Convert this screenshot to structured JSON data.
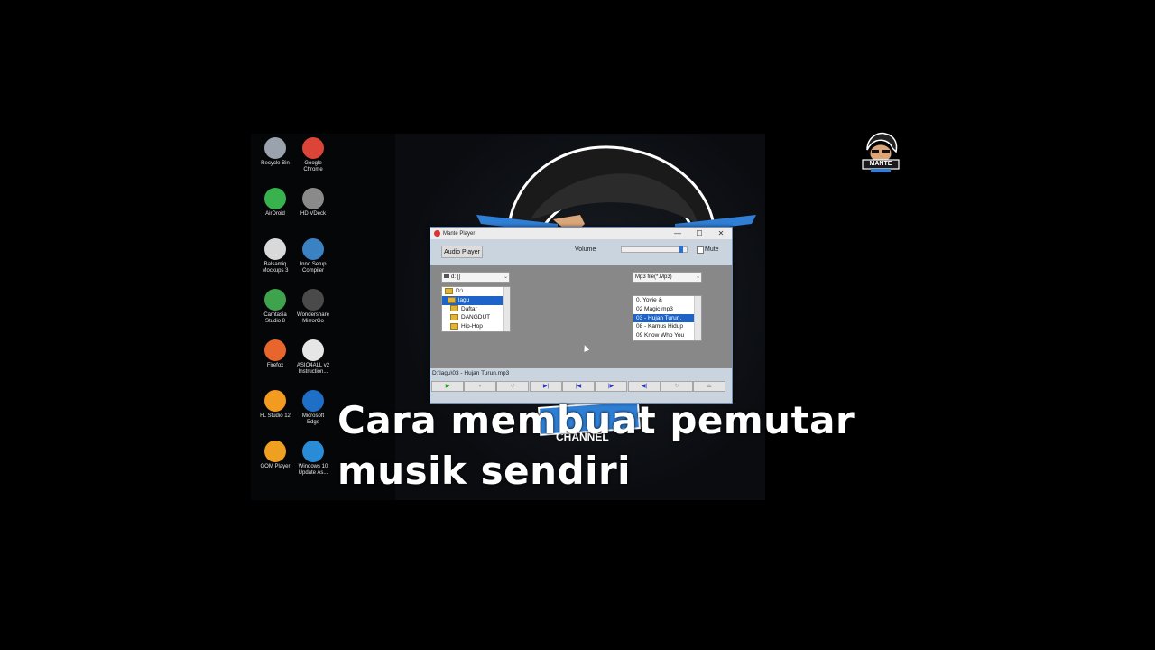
{
  "desktop": {
    "icons": [
      {
        "label": "Recycle Bin",
        "icon": "recycle-bin-icon",
        "color": "#9aa3ad"
      },
      {
        "label": "Google\nChrome",
        "icon": "chrome-icon",
        "color": "#db4437"
      },
      {
        "label": "AirDroid",
        "icon": "airdroid-icon",
        "color": "#37b24d"
      },
      {
        "label": "HD VDeck",
        "icon": "hd-vdeck-icon",
        "color": "#8a8a8a"
      },
      {
        "label": "Balsamiq\nMockups 3",
        "icon": "balsamiq-icon",
        "color": "#d9d9d9"
      },
      {
        "label": "Inno Setup\nCompiler",
        "icon": "inno-setup-icon",
        "color": "#3b82c4"
      },
      {
        "label": "Camtasia\nStudio 8",
        "icon": "camtasia-icon",
        "color": "#3fa34d"
      },
      {
        "label": "Wondershare\nMirrorGo",
        "icon": "mirrorgo-icon",
        "color": "#4a4a4a"
      },
      {
        "label": "Firefox",
        "icon": "firefox-icon",
        "color": "#e8652b"
      },
      {
        "label": "ASIO4ALL v2\nInstruction...",
        "icon": "pdf-icon",
        "color": "#e6e6e6"
      },
      {
        "label": "FL Studio 12",
        "icon": "fl-studio-icon",
        "color": "#f29b1f"
      },
      {
        "label": "Microsoft\nEdge",
        "icon": "edge-icon",
        "color": "#1e6fc8"
      },
      {
        "label": "GOM Player",
        "icon": "gom-player-icon",
        "color": "#f0a020"
      },
      {
        "label": "Windows 10\nUpdate As...",
        "icon": "windows-icon",
        "color": "#2a8bd6"
      }
    ]
  },
  "window": {
    "title": "Mante Player",
    "controls": {
      "minimize": "—",
      "maximize": "☐",
      "close": "✕"
    },
    "toolbar": {
      "audio_player_label": "Audio Player",
      "volume_label": "Volume",
      "volume_level": 0.94,
      "mute_label": "Mute"
    },
    "drive_combo": "d: []",
    "filter_combo": "Mp3 file(*.Mp3)",
    "folders": [
      {
        "name": "D:\\",
        "selected": false,
        "indent": 0
      },
      {
        "name": "lagu",
        "selected": true,
        "indent": 1
      },
      {
        "name": "Daftar",
        "selected": false,
        "indent": 2
      },
      {
        "name": "DANGDUT",
        "selected": false,
        "indent": 2
      },
      {
        "name": "Hip-Hop",
        "selected": false,
        "indent": 2
      }
    ],
    "files": [
      {
        "name": "0.      Yovie &",
        "selected": false
      },
      {
        "name": "02 Magic.mp3",
        "selected": false
      },
      {
        "name": "03 - Hujan Turun.",
        "selected": true
      },
      {
        "name": "08 - Kamus Hidup",
        "selected": false
      },
      {
        "name": "09 Know Who You",
        "selected": false
      }
    ],
    "status_path": "D:\\lagu\\03 - Hujan Turun.mp3",
    "transport": {
      "play": "▶",
      "pause": "⏸",
      "stop": "↺",
      "next": "▶|",
      "prev_start": "|◀",
      "forward": "|▶",
      "back": "◀|",
      "repeat": "↻",
      "eject": "⏏"
    }
  },
  "overlay": {
    "caption_line1": "Cara membuat pemutar",
    "caption_line2": "musik sendiri",
    "logo_text": "MANTE"
  },
  "colors": {
    "selection": "#1e63c8",
    "window_gray": "#8a8a8a",
    "toolbar_blue": "#c9d4de"
  }
}
